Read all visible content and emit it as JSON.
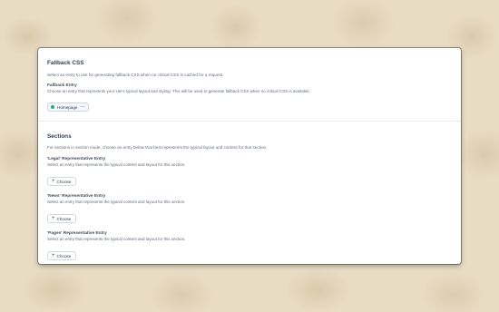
{
  "colors": {
    "background": "#e9dcc4",
    "status_enabled": "#27ab83",
    "heading": "#333f4d",
    "muted_text": "#5f6b7a"
  },
  "fallback": {
    "title": "Fallback CSS",
    "description": "Select an entry to use for generating fallback CSS when no critical CSS is cached for a request.",
    "field_label": "Fallback Entry",
    "field_description": "Choose an entry that represents your site's typical layout and styling. This will be used to generate fallback CSS when no critical CSS is available.",
    "selected_entry": "Homepage",
    "remove_glyph": "—"
  },
  "sections": {
    "title": "Sections",
    "description": "For sections in section mode, choose an entry below that best represents the typical layout and content for that section.",
    "entries": [
      {
        "label": "'Legal' Representative Entry",
        "description": "Select an entry that represents the typical content and layout for this section.",
        "button_label": "Choose"
      },
      {
        "label": "'News' Representative Entry",
        "description": "Select an entry that represents the typical content and layout for this section.",
        "button_label": "Choose"
      },
      {
        "label": "'Pages' Representative Entry",
        "description": "Select an entry that represents the typical content and layout for this section.",
        "button_label": "Choose"
      }
    ]
  },
  "icons": {
    "plus": "+",
    "status": "status-dot-icon"
  }
}
